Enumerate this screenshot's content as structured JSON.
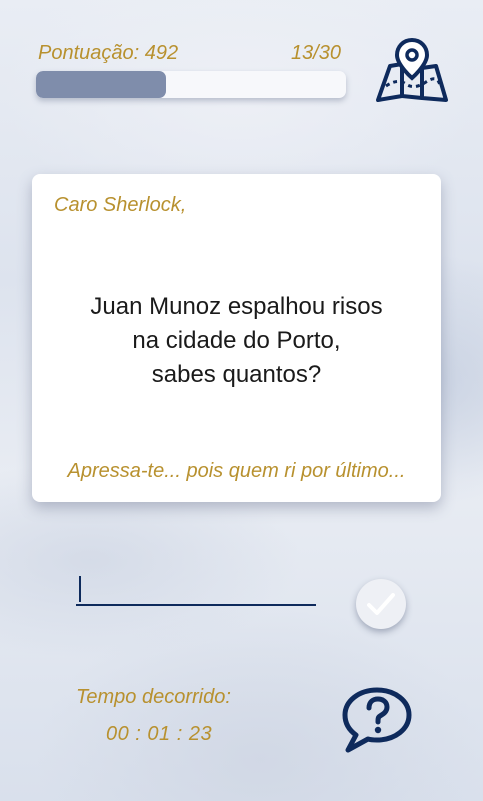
{
  "header": {
    "score_label": "Pontuação: 492",
    "progress_text": "13/30",
    "progress_fraction": 0.42,
    "map_icon": "map-location-icon"
  },
  "card": {
    "greeting": "Caro Sherlock,",
    "question_lines": [
      "Juan Munoz espalhou risos",
      "na cidade do Porto,",
      "sabes quantos?"
    ],
    "hint": "Apressa-te... pois quem ri por último..."
  },
  "answer": {
    "value": "",
    "submit_icon": "checkmark-icon"
  },
  "timer": {
    "label": "Tempo decorrido:",
    "value": "00 : 01 : 23"
  },
  "help": {
    "icon": "question-chat-icon"
  },
  "colors": {
    "accent_gold": "#b8912f",
    "navy": "#0e2a5c",
    "progress_fill": "#7f8dab"
  }
}
